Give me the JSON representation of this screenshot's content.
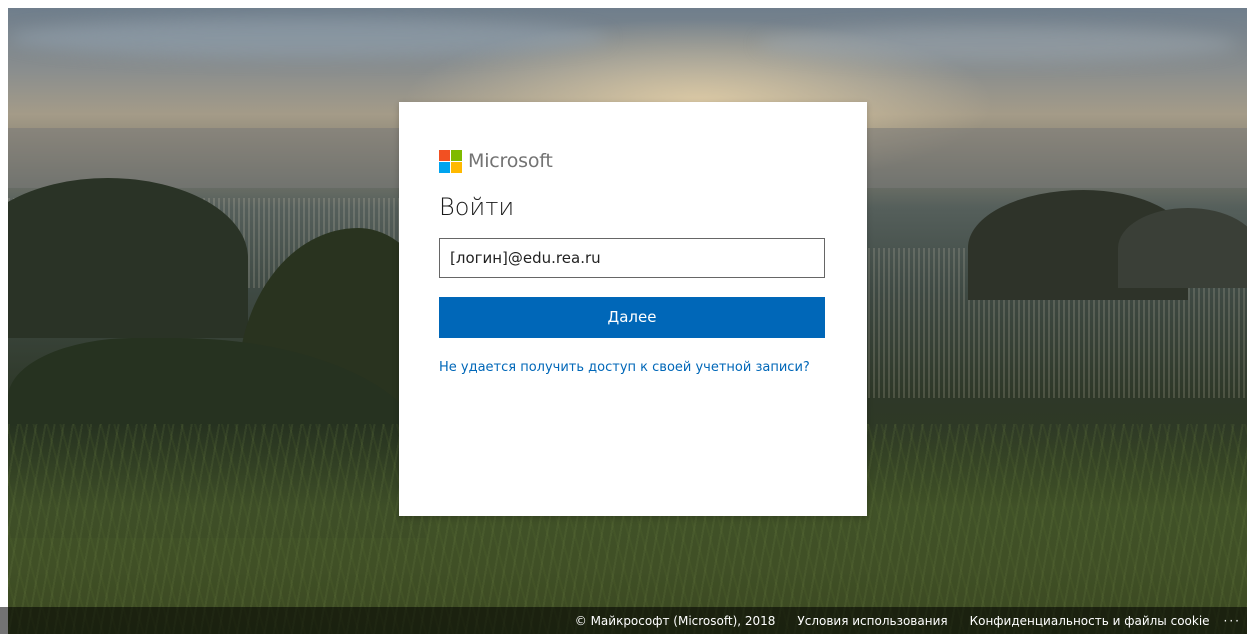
{
  "brand": {
    "name": "Microsoft",
    "logo_colors": [
      "#f25022",
      "#7fba00",
      "#00a4ef",
      "#ffb900"
    ]
  },
  "signin": {
    "title": "Войти",
    "email_value": "[логин]@edu.rea.ru",
    "next_label": "Далее",
    "help_link": "Не удается получить доступ к своей учетной записи?"
  },
  "footer": {
    "copyright": "© Майкрософт (Microsoft), 2018",
    "terms": "Условия использования",
    "privacy": "Конфиденциальность и файлы cookie",
    "more": "···"
  },
  "colors": {
    "accent": "#0067b8"
  }
}
